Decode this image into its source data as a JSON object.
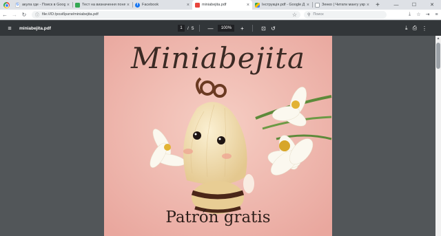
{
  "browser": {
    "tabs": [
      {
        "title": "акулa где - Поиск в Google",
        "favicon": "google-icon",
        "color": "#4285f4",
        "glyph": "G",
        "active": false
      },
      {
        "title": "Тест на визначення поня",
        "favicon": "docs-icon",
        "color": "#34a853",
        "glyph": "",
        "active": false
      },
      {
        "title": "Facebook",
        "favicon": "facebook-icon",
        "color": "#1877f2",
        "glyph": "f",
        "active": false
      },
      {
        "title": "miniabejita.pdf",
        "favicon": "pdf-icon",
        "color": "#e8453c",
        "glyph": "",
        "active": true
      },
      {
        "title": "Інструкція.pdf - Google Д",
        "favicon": "drive-icon",
        "color": "#fbbc04",
        "glyph": "",
        "active": false
      },
      {
        "title": "Зенко | Читати мангу укр",
        "favicon": "manga-icon",
        "color": "#9aa0a6",
        "glyph": "",
        "active": false
      }
    ],
    "close_glyph": "×",
    "newtab_glyph": "+",
    "window_controls": {
      "minimize": "—",
      "maximize": "☐",
      "close": "✕"
    },
    "address": "file:///D:/розібрати/miniabejita.pdf",
    "search_placeholder": "Поиск"
  },
  "pdf_toolbar": {
    "filename": "miniabejita.pdf",
    "page_current": "1",
    "page_separator": "/",
    "page_total": "5",
    "zoom": "100%",
    "zoom_out": "—",
    "zoom_in": "+"
  },
  "pdf_page": {
    "title": "Miniabejita",
    "subtitle": "Patrón gratis"
  }
}
